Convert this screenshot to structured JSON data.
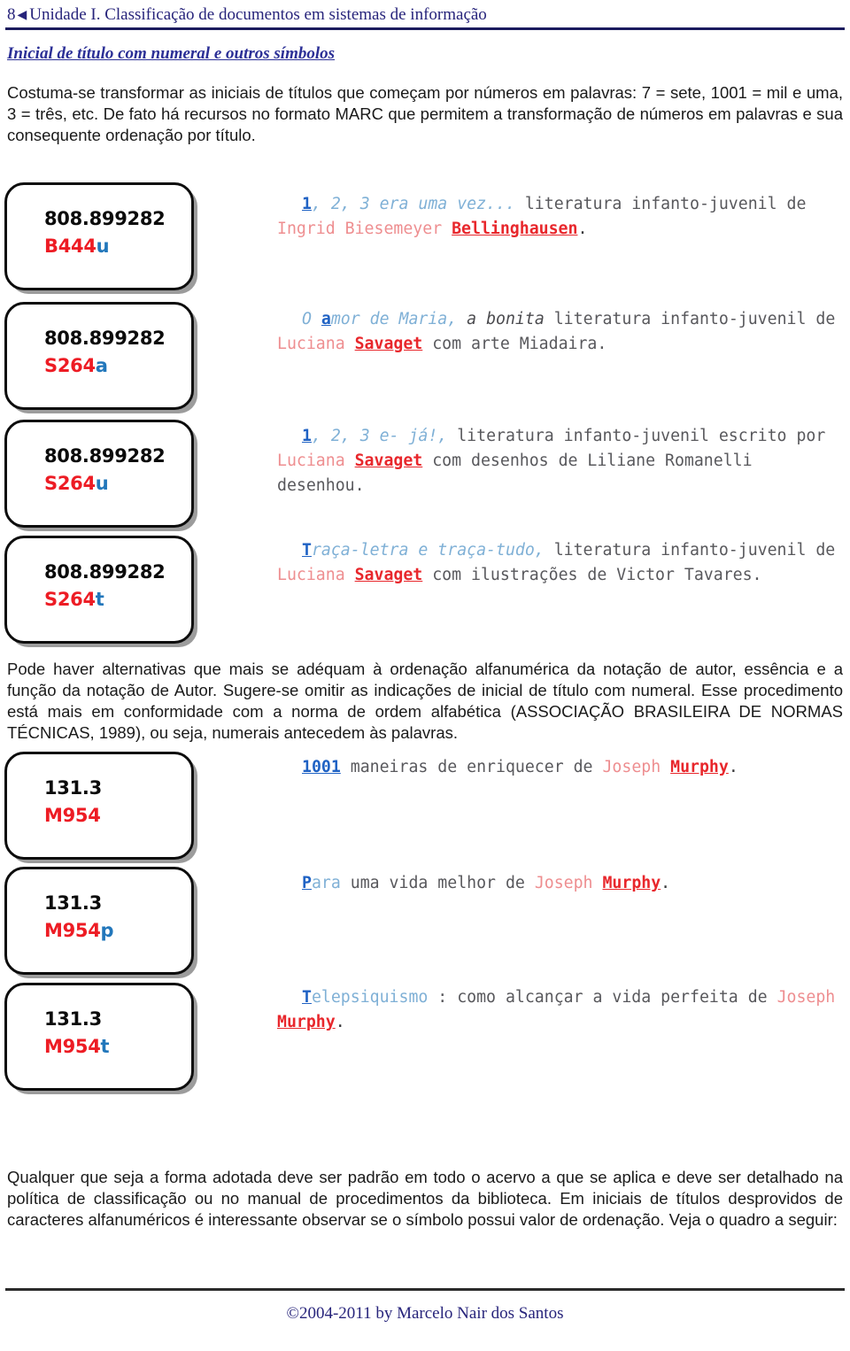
{
  "header": {
    "page_number": "8",
    "nav_arrow_glyph": "◀",
    "title": "Unidade I. Classificação de documentos em sistemas de informação"
  },
  "section": {
    "title": "Inicial de título com numeral e outros símbolos"
  },
  "paragraphs": {
    "intro": "Costuma-se transformar as iniciais de títulos que começam por números em palavras: 7 = sete, 1001 = mil e uma, 3 = três, etc. De fato há recursos no formato MARC que permitem a transformação de números em palavras e sua consequente ordenação por título.",
    "middle": "Pode haver alternativas que mais se adéquam à ordenação alfanumérica da notação de autor, essência e a função da notação de Autor. Sugere-se omitir as indicações de inicial de título com numeral. Esse procedimento está mais em conformidade com a norma de ordem alfabética (ASSOCIAÇÃO BRASILEIRA DE NORMAS TÉCNICAS, 1989), ou seja, numerais antecedem às palavras.",
    "end": "Qualquer que seja a forma adotada deve ser padrão em todo o acervo a que se aplica e deve ser detalhado na política de classificação ou no manual de procedimentos da biblioteca. Em iniciais de títulos desprovidos de caracteres alfanuméricos é interessante observar se o símbolo possui valor de ordenação. Veja o quadro a seguir:"
  },
  "records": [
    {
      "call_number": "808.899282",
      "cutter_main": "B444",
      "cutter_suffix": "u",
      "entry": {
        "init": "1",
        "title": ", 2, 3 era uma vez...",
        "rest_italic": "",
        "rest": " literatura infanto-juvenil de ",
        "author": "Ingrid Biesemeyer ",
        "surname": "Bellinghausen",
        "dot": "."
      }
    },
    {
      "call_number": "808.899282",
      "cutter_main": "S264",
      "cutter_suffix": "a",
      "entry": {
        "pre_title": "O ",
        "init": "a",
        "title": "mor de Maria,",
        "rest_italic": " a bonita",
        "rest": " literatura infanto-juvenil de ",
        "author": "Luciana ",
        "surname": "Savaget",
        "tail": " com arte Miadaira.",
        "dot": ""
      }
    },
    {
      "call_number": "808.899282",
      "cutter_main": "S264",
      "cutter_suffix": "u",
      "entry": {
        "init": "1",
        "title": ", 2, 3 e- já!,",
        "rest_italic": "",
        "rest": " literatura infanto-juvenil escrito por ",
        "author": "Luciana ",
        "surname": "Savaget",
        "tail": " com desenhos de Liliane Romanelli desenhou.",
        "dot": ""
      }
    },
    {
      "call_number": "808.899282",
      "cutter_main": "S264",
      "cutter_suffix": "t",
      "entry": {
        "init": "T",
        "title": "raça-letra e traça-tudo,",
        "rest_italic": "",
        "rest": " literatura infanto-juvenil de ",
        "author": "Luciana ",
        "surname": "Savaget",
        "tail": " com ilustrações de Victor Tavares.",
        "dot": ""
      }
    },
    {
      "call_number": "131.3",
      "cutter_main": "M954",
      "cutter_suffix": "",
      "entry": {
        "init": "1001",
        "title": "",
        "rest_italic": "",
        "rest": " maneiras de enriquecer de ",
        "author": "Joseph ",
        "surname": "Murphy",
        "tail": "",
        "dot": "."
      }
    },
    {
      "call_number": "131.3",
      "cutter_main": "M954",
      "cutter_suffix": "p",
      "entry": {
        "init": "P",
        "title": "ara",
        "rest_italic": "",
        "rest": " uma vida melhor de ",
        "author": "Joseph ",
        "surname": "Murphy",
        "tail": "",
        "dot": "."
      }
    },
    {
      "call_number": "131.3",
      "cutter_main": "M954",
      "cutter_suffix": "t",
      "entry": {
        "init": "T",
        "title": "elepsiquismo",
        "rest_italic": "",
        "rest": " : como alcançar a vida perfeita de ",
        "author": "Joseph ",
        "surname": "Murphy",
        "tail": "",
        "dot": "."
      }
    }
  ],
  "footer": {
    "copyright": "©2004-2011 by Marcelo Nair dos Santos"
  },
  "colors": {
    "header_blue": "#27247b",
    "section_blue": "#2b2f96",
    "cutter_red": "#ed1c24",
    "cutter_suffix_blue": "#2277bb",
    "entry_init_blue": "#1f62c4",
    "entry_title_blue": "#7fb0d6",
    "entry_author_red": "#ee8e90",
    "entry_surname_red": "#e8272c",
    "entry_body_gray": "#58585c",
    "rule_navy": "#1b1b5e",
    "box_shadow_gray": "#9c9c9c"
  }
}
